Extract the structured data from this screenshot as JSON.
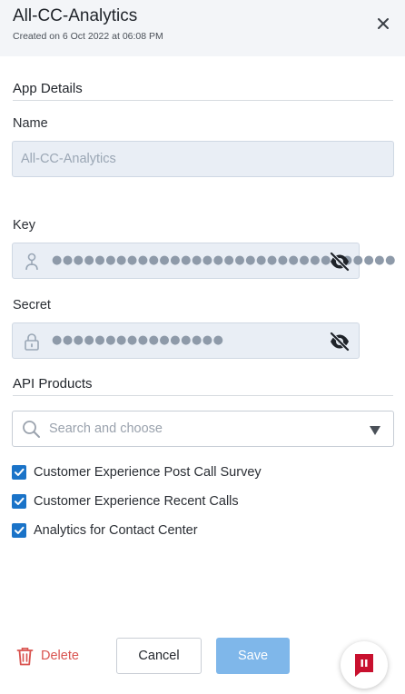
{
  "header": {
    "title": "All-CC-Analytics",
    "subtitle": "Created on 6 Oct 2022 at 06:08 PM"
  },
  "app_details": {
    "section_title": "App Details",
    "name_label": "Name",
    "name_value": "All-CC-Analytics",
    "key_label": "Key",
    "key_masked": "●●●●●●●●●●●●●●●●●●●●●●●●●●●●●●●●",
    "secret_label": "Secret",
    "secret_masked": "●●●●●●●●●●●●●●●●"
  },
  "api_products": {
    "section_title": "API Products",
    "search_placeholder": "Search and choose",
    "items": [
      {
        "label": "Customer Experience Post Call Survey",
        "checked": true
      },
      {
        "label": "Customer Experience Recent Calls",
        "checked": true
      },
      {
        "label": "Analytics for Contact Center",
        "checked": true
      }
    ]
  },
  "footer": {
    "delete_label": "Delete",
    "cancel_label": "Cancel",
    "save_label": "Save"
  },
  "colors": {
    "accent": "#1a73c8",
    "save_disabled": "#7fb7ea",
    "danger": "#d9534f",
    "header_bg": "#f3f5f8",
    "input_bg": "#e9eef5"
  },
  "icons": {
    "close": "close-icon",
    "key": "key-icon",
    "lock": "lock-icon",
    "eye_off": "eye-off-icon",
    "search": "search-icon",
    "dropdown": "caret-down-icon",
    "delete": "trash-icon",
    "fab": "chat-widget-icon"
  }
}
